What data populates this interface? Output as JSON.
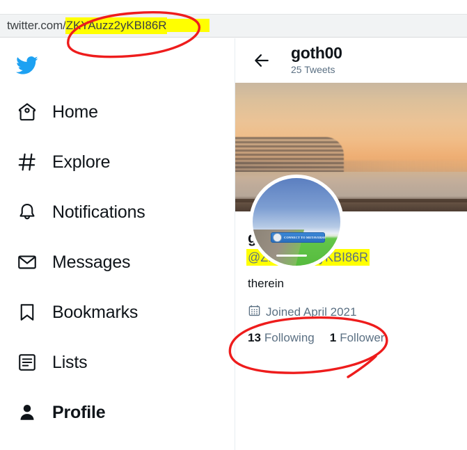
{
  "browser": {
    "url_prefix": "twitter.com/",
    "url_handle": "ZKYAuzz2yKBI86R"
  },
  "sidebar": {
    "logo": "twitter-bird-logo",
    "items": [
      {
        "label": "Home",
        "icon": "home-icon",
        "active": false
      },
      {
        "label": "Explore",
        "icon": "hashtag-icon",
        "active": false
      },
      {
        "label": "Notifications",
        "icon": "bell-icon",
        "active": false
      },
      {
        "label": "Messages",
        "icon": "envelope-icon",
        "active": false
      },
      {
        "label": "Bookmarks",
        "icon": "bookmark-icon",
        "active": false
      },
      {
        "label": "Lists",
        "icon": "list-icon",
        "active": false
      },
      {
        "label": "Profile",
        "icon": "person-filled-icon",
        "active": true
      }
    ]
  },
  "header": {
    "back_icon": "back-arrow-icon",
    "name": "goth00",
    "tweet_count": "25 Tweets"
  },
  "banner": {
    "alt": "sunset waterfront with building and railing"
  },
  "avatar": {
    "alt": "metaverse game screenshot",
    "button_label": "CONNECT TO METAVERSE"
  },
  "profile": {
    "display_name": "goth00",
    "handle": "@ZKYAuzz2yKBI86R",
    "bio": "therein",
    "joined_icon": "calendar-icon",
    "joined": "Joined April 2021",
    "stats": [
      {
        "count": "13",
        "label": "Following"
      },
      {
        "count": "1",
        "label": "Follower"
      }
    ]
  },
  "annotations": {
    "highlight_color": "#ffff00",
    "circle_color": "#ee1c1c",
    "accent_color": "#1da1f2"
  }
}
